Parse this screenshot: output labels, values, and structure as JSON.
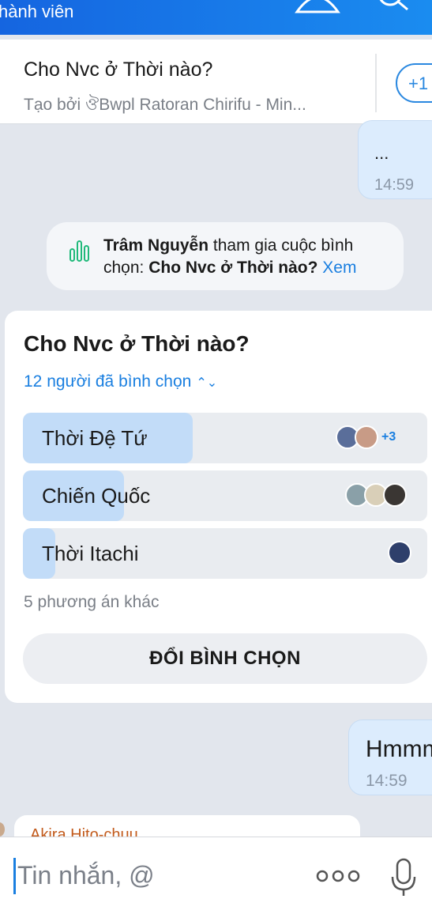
{
  "topbar": {
    "title": "hành viên"
  },
  "pinned": {
    "title": "Cho Nvc ở Thời nào?",
    "subtitle": "Tạo bởi ঔBwpl Ratoran Chirifu - Min...",
    "add_label": "+1"
  },
  "messages": {
    "out1": {
      "text": "...",
      "time": "14:59"
    },
    "out2": {
      "text": "Hmmm",
      "time": "14:59"
    },
    "incoming_name": "Akira Hito-chuu"
  },
  "notice": {
    "user": "Trâm Nguyễn",
    "action": " tham gia cuộc bình chọn: ",
    "poll": "Cho Nvc ở Thời nào?",
    "link": " Xem"
  },
  "poll": {
    "question": "Cho Nvc ở Thời nào?",
    "votes_label": "12 người đã bình chọn",
    "options": [
      {
        "label": "Thời Đệ Tứ",
        "share": 0.42,
        "extra": "+3"
      },
      {
        "label": "Chiến Quốc",
        "share": 0.25,
        "extra": ""
      },
      {
        "label": "Thời Itachi",
        "share": 0.08,
        "extra": ""
      }
    ],
    "others_label": "5 phương án khác",
    "change_button": "ĐỔI BÌNH CHỌN"
  },
  "input": {
    "placeholder": "Tin nhắn, @"
  },
  "colors": {
    "accent": "#1a7fe0",
    "topbar": "#1a7fe0",
    "bar_fill": "#c2dcf8"
  }
}
